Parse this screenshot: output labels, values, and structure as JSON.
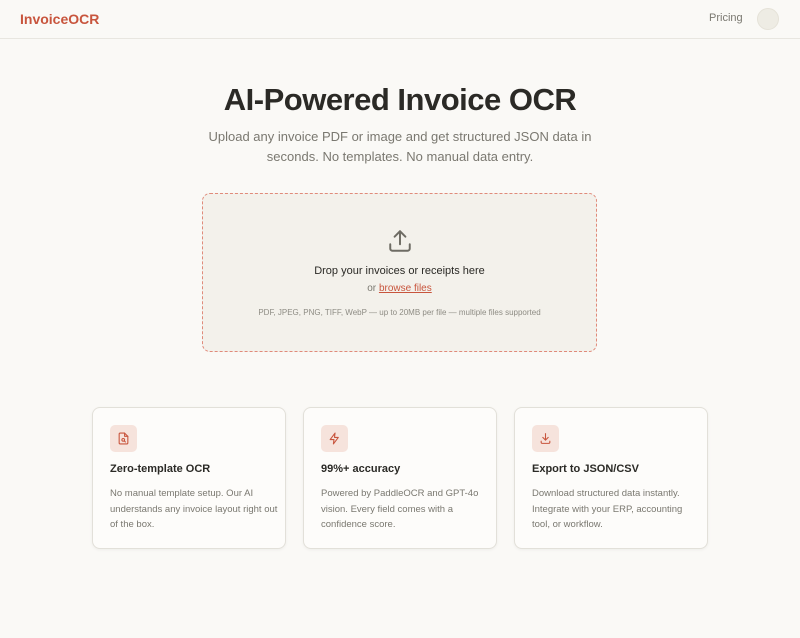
{
  "nav": {
    "logo": "InvoiceOCR",
    "pricing_label": "Pricing"
  },
  "hero": {
    "title": "AI-Powered Invoice OCR",
    "subtitle": "Upload any invoice PDF or image and get structured JSON data in seconds. No templates. No manual data entry."
  },
  "dropzone": {
    "icon": "upload-icon",
    "title": "Drop your invoices or receipts here",
    "or_text": "or",
    "browse_label": "browse files",
    "formats": "PDF, JPEG, PNG, TIFF, WebP — up to 20MB per file — multiple files supported"
  },
  "features": [
    {
      "icon": "document-search-icon",
      "title": "Zero-template OCR",
      "description": "No manual template setup. Our AI understands any invoice layout right out of the box."
    },
    {
      "icon": "lightning-icon",
      "title": "99%+ accuracy",
      "description": "Powered by PaddleOCR and GPT-4o vision. Every field comes with a confidence score."
    },
    {
      "icon": "download-icon",
      "title": "Export to JSON/CSV",
      "description": "Download structured data instantly. Integrate with your ERP, accounting tool, or workflow."
    }
  ],
  "colors": {
    "accent": "#c8553d",
    "background": "#faf9f6",
    "icon_tile": "#f6e3dc"
  }
}
